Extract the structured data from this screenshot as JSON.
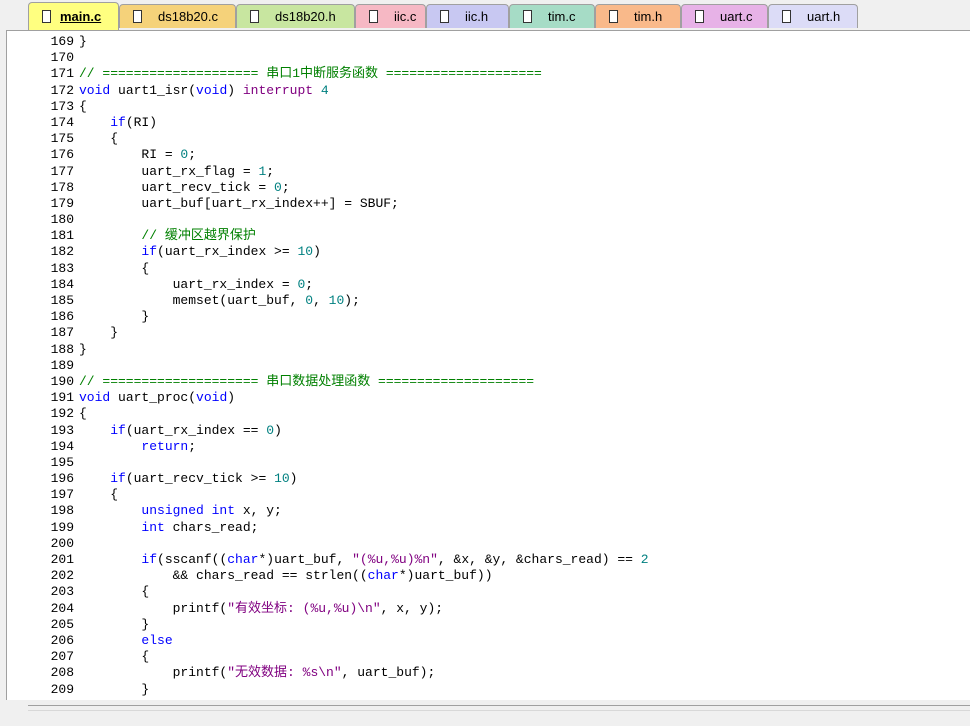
{
  "tabs": [
    {
      "label": "main.c",
      "color": "#ffff80",
      "active": true
    },
    {
      "label": "ds18b20.c",
      "color": "#f5d27a"
    },
    {
      "label": "ds18b20.h",
      "color": "#c8e6a0"
    },
    {
      "label": "iic.c",
      "color": "#f6b8c4"
    },
    {
      "label": "iic.h",
      "color": "#c8c8f2"
    },
    {
      "label": "tim.c",
      "color": "#a6dcc6"
    },
    {
      "label": "tim.h",
      "color": "#f9b98a"
    },
    {
      "label": "uart.c",
      "color": "#e7b2e7"
    },
    {
      "label": "uart.h",
      "color": "#dcdcf7"
    }
  ],
  "colors": {
    "keyword": "#0000ff",
    "comment": "#008000",
    "number": "#008080",
    "string": "#800080",
    "macro": "#800080"
  },
  "lines": [
    {
      "num": "169",
      "code": [
        [
          "}",
          "pl"
        ]
      ]
    },
    {
      "num": "170",
      "code": []
    },
    {
      "num": "171",
      "code": [
        [
          "// ==================== 串口1中断服务函数 ====================",
          "cm"
        ]
      ]
    },
    {
      "num": "172",
      "code": [
        [
          "void",
          "kw"
        ],
        [
          " uart1_isr(",
          "pl"
        ],
        [
          "void",
          "kw"
        ],
        [
          ") ",
          "pl"
        ],
        [
          "interrupt",
          "mac"
        ],
        [
          " ",
          "pl"
        ],
        [
          "4",
          "num"
        ]
      ]
    },
    {
      "num": "173",
      "code": [
        [
          "{",
          "pl"
        ]
      ]
    },
    {
      "num": "174",
      "code": [
        [
          "    ",
          "pl"
        ],
        [
          "if",
          "kw"
        ],
        [
          "(RI)",
          "pl"
        ]
      ]
    },
    {
      "num": "175",
      "code": [
        [
          "    {",
          "pl"
        ]
      ]
    },
    {
      "num": "176",
      "code": [
        [
          "        RI = ",
          "pl"
        ],
        [
          "0",
          "num"
        ],
        [
          ";",
          "pl"
        ]
      ]
    },
    {
      "num": "177",
      "code": [
        [
          "        uart_rx_flag = ",
          "pl"
        ],
        [
          "1",
          "num"
        ],
        [
          ";",
          "pl"
        ]
      ]
    },
    {
      "num": "178",
      "code": [
        [
          "        uart_recv_tick = ",
          "pl"
        ],
        [
          "0",
          "num"
        ],
        [
          ";",
          "pl"
        ]
      ]
    },
    {
      "num": "179",
      "code": [
        [
          "        uart_buf[uart_rx_index++] = SBUF;",
          "pl"
        ]
      ]
    },
    {
      "num": "180",
      "code": []
    },
    {
      "num": "181",
      "code": [
        [
          "        ",
          "pl"
        ],
        [
          "// 缓冲区越界保护",
          "cm"
        ]
      ]
    },
    {
      "num": "182",
      "code": [
        [
          "        ",
          "pl"
        ],
        [
          "if",
          "kw"
        ],
        [
          "(uart_rx_index >= ",
          "pl"
        ],
        [
          "10",
          "num"
        ],
        [
          ")",
          "pl"
        ]
      ]
    },
    {
      "num": "183",
      "code": [
        [
          "        {",
          "pl"
        ]
      ]
    },
    {
      "num": "184",
      "code": [
        [
          "            uart_rx_index = ",
          "pl"
        ],
        [
          "0",
          "num"
        ],
        [
          ";",
          "pl"
        ]
      ]
    },
    {
      "num": "185",
      "code": [
        [
          "            memset(uart_buf, ",
          "pl"
        ],
        [
          "0",
          "num"
        ],
        [
          ", ",
          "pl"
        ],
        [
          "10",
          "num"
        ],
        [
          ");",
          "pl"
        ]
      ]
    },
    {
      "num": "186",
      "code": [
        [
          "        }",
          "pl"
        ]
      ]
    },
    {
      "num": "187",
      "code": [
        [
          "    }",
          "pl"
        ]
      ]
    },
    {
      "num": "188",
      "code": [
        [
          "}",
          "pl"
        ]
      ]
    },
    {
      "num": "189",
      "code": []
    },
    {
      "num": "190",
      "code": [
        [
          "// ==================== 串口数据处理函数 ====================",
          "cm"
        ]
      ]
    },
    {
      "num": "191",
      "code": [
        [
          "void",
          "kw"
        ],
        [
          " uart_proc(",
          "pl"
        ],
        [
          "void",
          "kw"
        ],
        [
          ")",
          "pl"
        ]
      ]
    },
    {
      "num": "192",
      "code": [
        [
          "{",
          "pl"
        ]
      ]
    },
    {
      "num": "193",
      "code": [
        [
          "    ",
          "pl"
        ],
        [
          "if",
          "kw"
        ],
        [
          "(uart_rx_index == ",
          "pl"
        ],
        [
          "0",
          "num"
        ],
        [
          ")",
          "pl"
        ]
      ]
    },
    {
      "num": "194",
      "code": [
        [
          "        ",
          "pl"
        ],
        [
          "return",
          "kw"
        ],
        [
          ";",
          "pl"
        ]
      ]
    },
    {
      "num": "195",
      "code": []
    },
    {
      "num": "196",
      "code": [
        [
          "    ",
          "pl"
        ],
        [
          "if",
          "kw"
        ],
        [
          "(uart_recv_tick >= ",
          "pl"
        ],
        [
          "10",
          "num"
        ],
        [
          ")",
          "pl"
        ]
      ]
    },
    {
      "num": "197",
      "code": [
        [
          "    {",
          "pl"
        ]
      ]
    },
    {
      "num": "198",
      "code": [
        [
          "        ",
          "pl"
        ],
        [
          "unsigned int",
          "kw"
        ],
        [
          " x, y;",
          "pl"
        ]
      ]
    },
    {
      "num": "199",
      "code": [
        [
          "        ",
          "pl"
        ],
        [
          "int",
          "kw"
        ],
        [
          " chars_read;",
          "pl"
        ]
      ]
    },
    {
      "num": "200",
      "code": []
    },
    {
      "num": "201",
      "code": [
        [
          "        ",
          "pl"
        ],
        [
          "if",
          "kw"
        ],
        [
          "(sscanf((",
          "pl"
        ],
        [
          "char",
          "kw"
        ],
        [
          "*)uart_buf, ",
          "pl"
        ],
        [
          "\"(%u,%u)%n\"",
          "str"
        ],
        [
          ", &x, &y, &chars_read) == ",
          "pl"
        ],
        [
          "2",
          "num"
        ]
      ]
    },
    {
      "num": "202",
      "code": [
        [
          "            && chars_read == strlen((",
          "pl"
        ],
        [
          "char",
          "kw"
        ],
        [
          "*)uart_buf))",
          "pl"
        ]
      ]
    },
    {
      "num": "203",
      "code": [
        [
          "        {",
          "pl"
        ]
      ]
    },
    {
      "num": "204",
      "code": [
        [
          "            printf(",
          "pl"
        ],
        [
          "\"有效坐标: (%u,%u)\\n\"",
          "str"
        ],
        [
          ", x, y);",
          "pl"
        ]
      ]
    },
    {
      "num": "205",
      "code": [
        [
          "        }",
          "pl"
        ]
      ]
    },
    {
      "num": "206",
      "code": [
        [
          "        ",
          "pl"
        ],
        [
          "else",
          "kw"
        ]
      ]
    },
    {
      "num": "207",
      "code": [
        [
          "        {",
          "pl"
        ]
      ]
    },
    {
      "num": "208",
      "code": [
        [
          "            printf(",
          "pl"
        ],
        [
          "\"无效数据: %s\\n\"",
          "str"
        ],
        [
          ", uart_buf);",
          "pl"
        ]
      ]
    },
    {
      "num": "209",
      "code": [
        [
          "        }",
          "pl"
        ]
      ]
    }
  ]
}
